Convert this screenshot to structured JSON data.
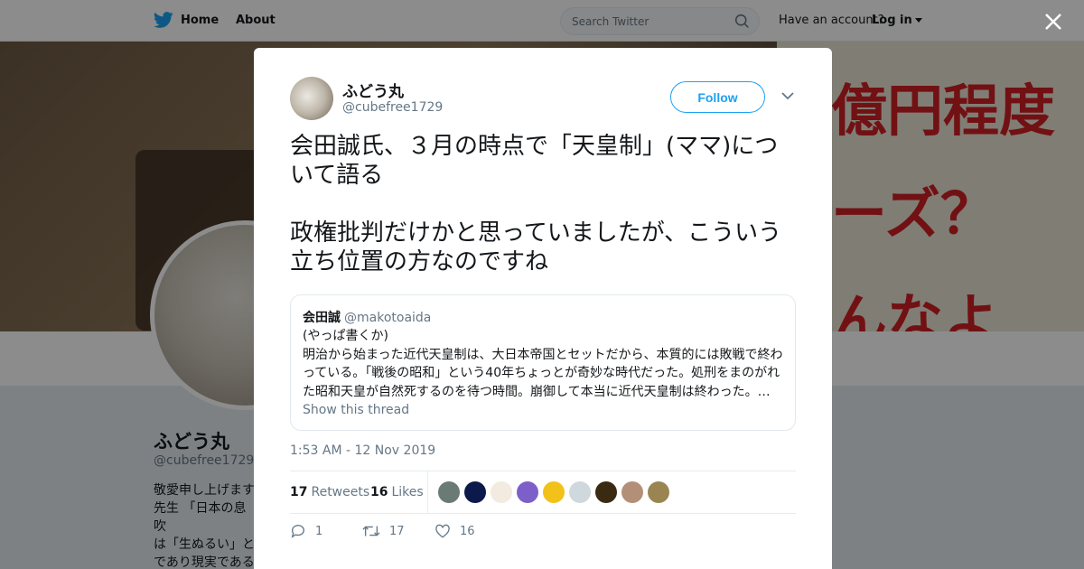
{
  "nav": {
    "home": "Home",
    "about": "About",
    "search_placeholder": "Search Twitter",
    "have_account": "Have an account?",
    "login": "Log in"
  },
  "banner": {
    "line1": "億円程度",
    "line2": "ーズ？",
    "line3": "んなよ"
  },
  "profile": {
    "name": "ふどう丸",
    "handle": "@cubefree1729",
    "bio": "敬愛申し上げます\n先生 「日本の息吹\nは「生ぬるい」と\nであり現実である\n一の凡策である」"
  },
  "tweet": {
    "author_name": "ふどう丸",
    "author_handle": "@cubefree1729",
    "follow_label": "Follow",
    "text": "会田誠氏、３月の時点で「天皇制」(ママ)について語る\n\n政権批判だけかと思っていましたが、こういう立ち位置の方なのですね",
    "quote": {
      "name": "会田誠",
      "handle": "@makotoaida",
      "body": "(やっぱ書くか)\n明治から始まった近代天皇制は、大日本帝国とセットだから、本質的には敗戦で終わっている。「戦後の昭和」という40年ちょっとが奇妙な時代だった。処刑をまのがれた昭和天皇が自然死するのを待つ時間。崩御して本当に近代天皇制は終わった。…",
      "show_thread": "Show this thread"
    },
    "timestamp": "1:53 AM - 12 Nov 2019",
    "retweets_count": "17",
    "retweets_label": "Retweets",
    "likes_count": "16",
    "likes_label": "Likes",
    "reply_count": "1",
    "retweet_action_count": "17",
    "like_action_count": "16"
  },
  "colors": {
    "accent": "#1da1f2",
    "banner_text": "#cf1f24"
  },
  "icons": [
    "twitter-bird-icon",
    "search-icon",
    "caret-down-icon",
    "close-icon",
    "chevron-down-icon",
    "reply-icon",
    "retweet-icon",
    "heart-icon"
  ]
}
